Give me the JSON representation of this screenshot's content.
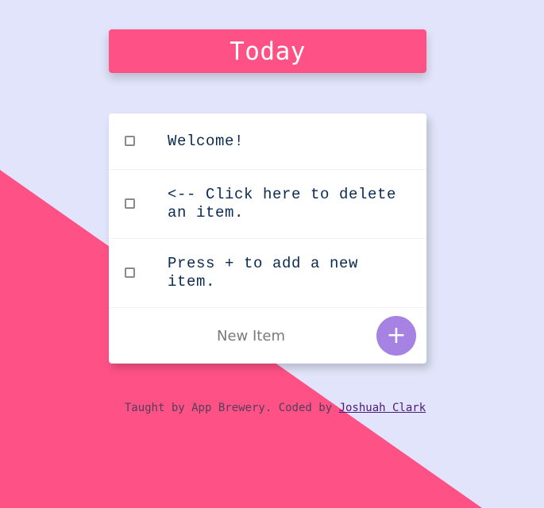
{
  "heading": {
    "title": "Today"
  },
  "items": [
    {
      "text": "Welcome!",
      "checked": false
    },
    {
      "text": "<-- Click here to delete an item.",
      "checked": false
    },
    {
      "text": "Press + to add a new item.",
      "checked": false
    }
  ],
  "new_item": {
    "placeholder": "New Item",
    "add_label": "+"
  },
  "footer": {
    "text": "Taught by App Brewery. Coded by ",
    "link_text": "Joshuah Clark"
  },
  "colors": {
    "background": "#e1e4fa",
    "accent_pink": "#fe5186",
    "add_button": "#a683e3",
    "item_text": "#0a2a4f"
  },
  "icons": {
    "checkbox": "checkbox-icon",
    "add": "plus-icon"
  }
}
